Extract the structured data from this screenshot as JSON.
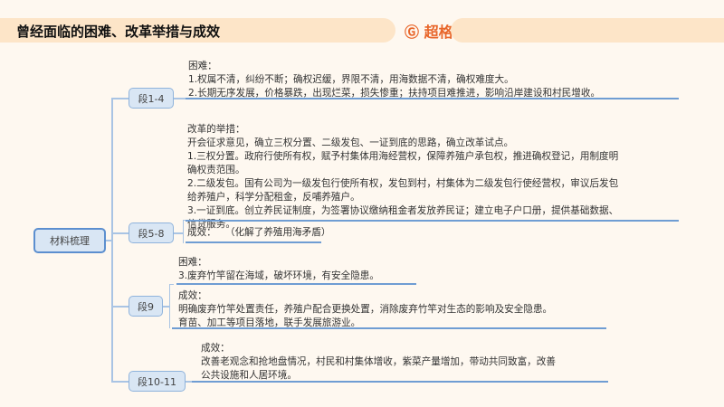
{
  "header": {
    "title": "曾经面临的困难、改革举措与成效",
    "logo_text": "超格",
    "logo_icon": "c-logo-icon"
  },
  "root": {
    "label": "材料梳理"
  },
  "branches": [
    {
      "label": "段1-4",
      "blocks": [
        {
          "heading": "困难：",
          "lines": [
            "1.权属不清，纠纷不断；确权迟缓，界限不清，用海数据不清，确权难度大。",
            "2.长期无序发展，价格暴跌，出现烂菜，损失惨重；扶持项目难推进，影响沿岸建设和村民增收。"
          ]
        }
      ]
    },
    {
      "label": "段5-8",
      "blocks": [
        {
          "heading": "改革的举措：",
          "lines": [
            "开会征求意见，确立三权分置、二级发包、一证到底的思路，确立改革试点。",
            "1.三权分置。政府行使所有权，赋予村集体用海经营权，保障养殖户承包权，推进确权登记，用制度明",
            "确权责范围。",
            "2.二级发包。国有公司为一级发包行使所有权，发包到村，村集体为二级发包行使经营权，审议后发包",
            "给养殖户，科学分配租金，反哺养殖户。",
            "3.一证到底。创立养民证制度，为签署协议缴纳租金者发放养民证；建立电子户口册，提供基础数据、",
            "信贷服务。"
          ]
        },
        {
          "heading": "成效：",
          "lines": [
            "（化解了养殖用海矛盾）"
          ]
        }
      ]
    },
    {
      "label": "段9",
      "blocks": [
        {
          "heading": "困难：",
          "lines": [
            "3.废弃竹竿留在海域，破坏环境，有安全隐患。"
          ]
        },
        {
          "heading": "成效：",
          "lines": [
            "明确废弃竹竿处置责任，养殖户配合更换处置，消除废弃竹竿对生态的影响及安全隐患。",
            "育苗、加工等项目落地，联手发展旅游业。"
          ]
        }
      ]
    },
    {
      "label": "段10-11",
      "blocks": [
        {
          "heading": "成效：",
          "lines": [
            "改善老观念和抢地盘情况，村民和村集体增收，紫菜产量增加，带动共同致富，改善",
            "公共设施和人居环境。"
          ]
        }
      ]
    }
  ]
}
